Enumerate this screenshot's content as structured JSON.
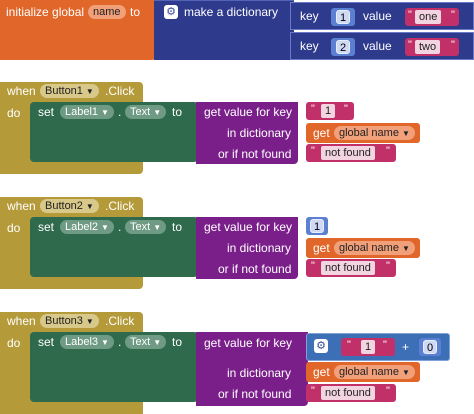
{
  "init_block": {
    "label": "initialize global",
    "var_name": "name",
    "to": "to",
    "make_dict": "make a dictionary",
    "pairs": [
      {
        "key_label": "key",
        "key": "1",
        "value_label": "value",
        "value": "one"
      },
      {
        "key_label": "key",
        "key": "2",
        "value_label": "value",
        "value": "two"
      }
    ]
  },
  "handlers": [
    {
      "when": "when",
      "component": "Button1",
      "event": ".Click",
      "do": "do",
      "set": "set",
      "target": "Label1",
      "dot": ".",
      "prop": "Text",
      "to": "to",
      "get_key": "get value for key",
      "key_value": "1",
      "in_dict": "in dictionary",
      "get": "get",
      "global": "global name",
      "not_found_label": "or if not found",
      "not_found": "not found"
    },
    {
      "when": "when",
      "component": "Button2",
      "event": ".Click",
      "do": "do",
      "set": "set",
      "target": "Label2",
      "dot": ".",
      "prop": "Text",
      "to": "to",
      "get_key": "get value for key",
      "key_value": "1",
      "in_dict": "in dictionary",
      "get": "get",
      "global": "global name",
      "not_found_label": "or if not found",
      "not_found": "not found"
    },
    {
      "when": "when",
      "component": "Button3",
      "event": ".Click",
      "do": "do",
      "set": "set",
      "target": "Label3",
      "dot": ".",
      "prop": "Text",
      "to": "to",
      "get_key": "get value for key",
      "key_value": "1",
      "plus": "+",
      "addend": "0",
      "in_dict": "in dictionary",
      "get": "get",
      "global": "global name",
      "not_found_label": "or if not found",
      "not_found": "not found"
    }
  ],
  "colors": {
    "variable": "#e0662a",
    "dictionary": "#2e3a8c",
    "event": "#b59a3a",
    "setter": "#2f6a4d",
    "getter": "#7a1f8a",
    "text": "#c2306a",
    "math": "#3d6fb7",
    "number": "#5b7fd1"
  }
}
